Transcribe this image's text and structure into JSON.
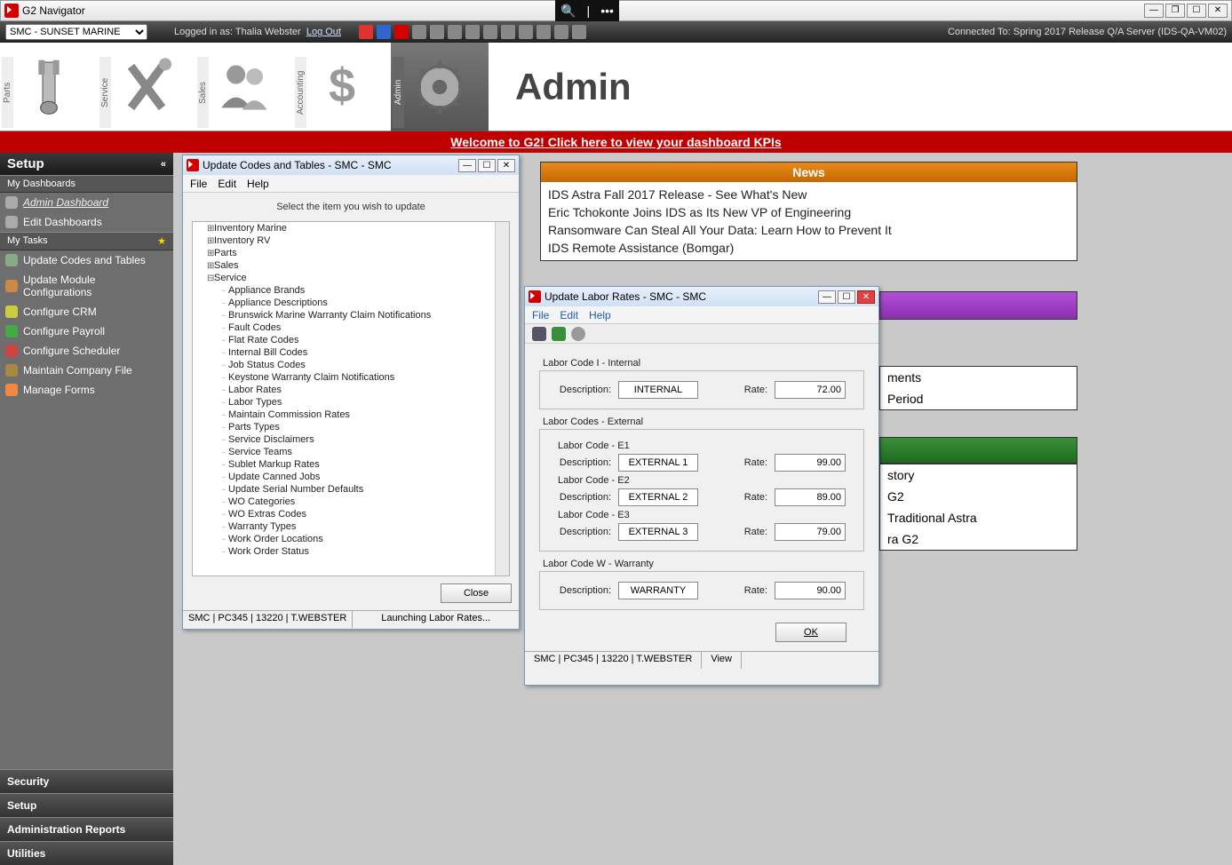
{
  "app": {
    "title": "G2 Navigator"
  },
  "wincontrols": {
    "min": "—",
    "restore": "❐",
    "max": "☐",
    "close": "✕"
  },
  "overlay": {
    "zoom": "🔍",
    "sep": "|",
    "more": "•••"
  },
  "topbar": {
    "location_selected": "SMC - SUNSET MARINE",
    "login_prefix": "Logged in as: ",
    "user": "Thalia Webster",
    "logout": "Log Out",
    "connected": "Connected To: Spring 2017 Release Q/A Server (IDS-QA-VM02)"
  },
  "bigicons": {
    "parts": "Parts",
    "service": "Service",
    "sales": "Sales",
    "accounting": "Accounting",
    "admin": "Admin",
    "page_title": "Admin"
  },
  "banner": "Welcome to G2!   Click here to view your dashboard KPIs",
  "sidebar": {
    "setup": "Setup",
    "dash_head": "My Dashboards",
    "admin_dash": "Admin Dashboard",
    "edit_dash": "Edit Dashboards",
    "tasks_head": "My Tasks",
    "tasks": [
      "Update Codes and Tables",
      "Update Module Configurations",
      "Configure CRM",
      "Configure Payroll",
      "Configure Scheduler",
      "Maintain Company File",
      "Manage Forms"
    ],
    "bottom": [
      "Security",
      "Setup",
      "Administration Reports",
      "Utilities"
    ]
  },
  "news": {
    "head": "News",
    "items": [
      "IDS Astra Fall 2017 Release - See What's New",
      "Eric Tchokonte Joins IDS as Its New VP of Engineering",
      "Ransomware Can Steal All Your Data: Learn How to Prevent It",
      "IDS Remote Assistance (Bomgar)"
    ]
  },
  "rightlinks": {
    "a": "ments",
    "b": "Period",
    "c": "story",
    "d": "G2",
    "e": "Traditional Astra",
    "f": "ra G2"
  },
  "uc": {
    "title": "Update Codes and Tables - SMC - SMC",
    "menus": {
      "file": "File",
      "edit": "Edit",
      "help": "Help"
    },
    "instr": "Select the item you wish to update",
    "tree_top": [
      "Inventory Marine",
      "Inventory RV",
      "Parts",
      "Sales",
      "Service"
    ],
    "service_children": [
      "Appliance Brands",
      "Appliance Descriptions",
      "Brunswick Marine Warranty Claim Notifications",
      "Fault Codes",
      "Flat Rate Codes",
      "Internal Bill Codes",
      "Job Status Codes",
      "Keystone Warranty Claim Notifications",
      "Labor Rates",
      "Labor Types",
      "Maintain Commission Rates",
      "Parts Types",
      "Service Disclaimers",
      "Service Teams",
      "Sublet Markup Rates",
      "Update Canned Jobs",
      "Update Serial Number Defaults",
      "WO Categories",
      "WO Extras Codes",
      "Warranty Types",
      "Work Order Locations",
      "Work Order Status"
    ],
    "close": "Close",
    "status_left": "SMC | PC345 | 13220 | T.WEBSTER",
    "status_right": "Launching Labor Rates..."
  },
  "lr": {
    "title": "Update Labor Rates - SMC - SMC",
    "menus": {
      "file": "File",
      "edit": "Edit",
      "help": "Help"
    },
    "grp_internal": "Labor Code I - Internal",
    "grp_external": "Labor Codes - External",
    "sub_e1": "Labor Code - E1",
    "sub_e2": "Labor Code - E2",
    "sub_e3": "Labor Code - E3",
    "grp_warranty": "Labor Code W - Warranty",
    "lbl_desc": "Description:",
    "lbl_rate": "Rate:",
    "internal": {
      "desc": "INTERNAL",
      "rate": "72.00"
    },
    "e1": {
      "desc": "EXTERNAL 1",
      "rate": "99.00"
    },
    "e2": {
      "desc": "EXTERNAL 2",
      "rate": "89.00"
    },
    "e3": {
      "desc": "EXTERNAL 3",
      "rate": "79.00"
    },
    "warranty": {
      "desc": "WARRANTY",
      "rate": "90.00"
    },
    "ok": "OK",
    "status_left": "SMC | PC345 | 13220 | T.WEBSTER",
    "status_right": "View"
  }
}
